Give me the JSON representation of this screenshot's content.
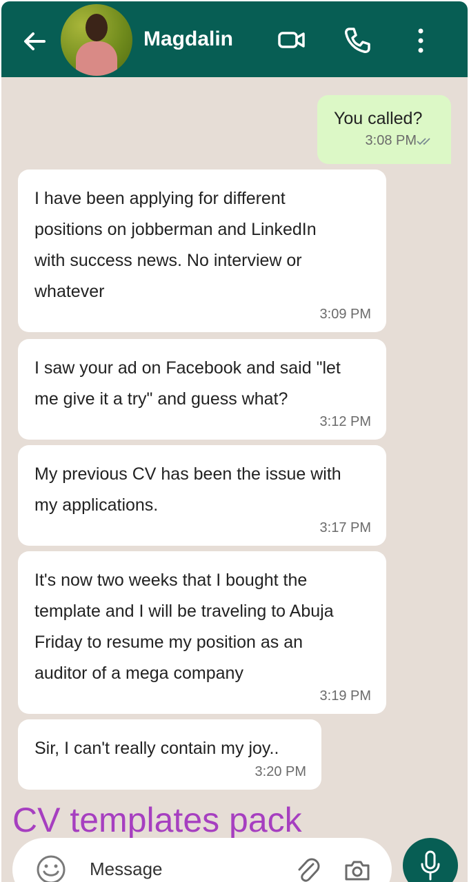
{
  "header": {
    "contact_name": "Magdalin",
    "icons": [
      "back-arrow-icon",
      "avatar",
      "video-call-icon",
      "voice-call-icon",
      "more-options-icon"
    ],
    "color": "#075e54"
  },
  "messages": [
    {
      "direction": "outgoing",
      "text": "You called?",
      "time": "3:08 PM",
      "status": "read"
    },
    {
      "direction": "incoming",
      "lines": [
        "I have been applying for different",
        "positions on jobberman and LinkedIn",
        "with success news. No interview or",
        "whatever"
      ],
      "time": "3:09 PM"
    },
    {
      "direction": "incoming",
      "lines": [
        "I saw your ad on Facebook and said \"let",
        "me give it a try\" and guess what?"
      ],
      "time": "3:12 PM"
    },
    {
      "direction": "incoming",
      "lines": [
        "My previous CV has been the issue with",
        "my applications."
      ],
      "time": "3:17 PM"
    },
    {
      "direction": "incoming",
      "lines": [
        "It's now two weeks that I bought the",
        "template and I will be traveling to Abuja",
        "Friday to resume my position as an",
        "auditor of a mega company"
      ],
      "time": "3:19 PM"
    },
    {
      "direction": "incoming",
      "lines": [
        "Sir, I can't really contain my joy.."
      ],
      "time": "3:20 PM"
    }
  ],
  "overlay_text": "CV templates pack",
  "overlay_color": "#a63fc0",
  "input": {
    "placeholder": "Message"
  },
  "colors": {
    "chat_bg": "#e6ddd6",
    "outgoing_bubble": "#dcf8c6",
    "incoming_bubble": "#ffffff"
  }
}
